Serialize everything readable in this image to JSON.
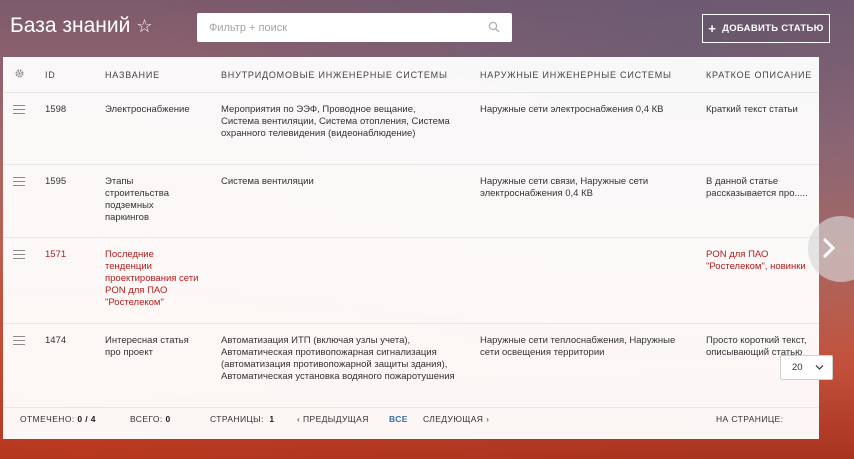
{
  "header": {
    "title": "База знаний",
    "star_icon": "star-icon",
    "search_placeholder": "Фильтр + поиск",
    "add_button_label": "ДОБАВИТЬ СТАТЬЮ"
  },
  "table": {
    "columns": [
      "ID",
      "НАЗВАНИЕ",
      "ВНУТРИДОМОВЫЕ ИНЖЕНЕРНЫЕ СИСТЕМЫ",
      "НАРУЖНЫЕ ИНЖЕНЕРНЫЕ СИСТЕМЫ",
      "КРАТКОЕ ОПИСАНИЕ"
    ],
    "rows": [
      {
        "id": "1598",
        "name": "Электроснабжение",
        "internal": "Мероприятия по ЭЭФ, Проводное вещание, Система вентиляции, Система отопления, Система охранного телевидения (видеонаблюдение)",
        "external": "Наружные сети электроснабжения 0,4 КВ",
        "description": "Краткий текст статьи"
      },
      {
        "id": "1595",
        "name": "Этапы строительства подземных паркингов",
        "internal": "Система вентиляции",
        "external": "Наружные сети связи, Наружные сети электроснабжения 0,4 КВ",
        "description": "В данной статье рассказывается про....."
      },
      {
        "id": "1571",
        "name": "Последние тенденции проектирования сети PON для ПАО \"Ростелеком\"",
        "internal": "",
        "external": "",
        "description": "PON для ПАО \"Ростелеком\", новинки"
      },
      {
        "id": "1474",
        "name": "Интересная статья про проект",
        "internal": "Автоматизация ИТП (включая узлы учета), Автоматическая противопожарная сигнализация (автоматизация противопожарной защиты здания), Автоматическая установка водяного пожаротушения",
        "external": "Наружные сети теплоснабжения, Наружные сети освещения территории",
        "description": "Просто короткий текст, описывающий статью"
      }
    ]
  },
  "footer": {
    "selected_label": "ОТМЕЧЕНО:",
    "selected_value": "0 / 4",
    "total_label": "ВСЕГО:",
    "total_value": "0",
    "pages_label": "СТРАНИЦЫ:",
    "pages_value": "1",
    "prev_label": "ПРЕДЫДУЩАЯ",
    "all_label": "ВСЕ",
    "next_label": "СЛЕДУЮЩАЯ",
    "per_page_label": "НА СТРАНИЦЕ:",
    "per_page_value": "20"
  },
  "colors": {
    "highlight_row": "#b31c1c",
    "link": "#3a6ea5"
  }
}
